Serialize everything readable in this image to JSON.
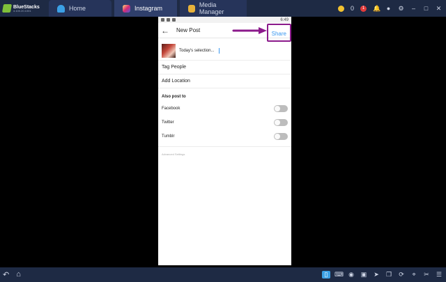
{
  "app": {
    "name": "BlueStacks",
    "version": "4.100.20.1001",
    "tabs": [
      {
        "label": "Home",
        "icon": "home-icon"
      },
      {
        "label": "Instagram",
        "icon": "instagram-icon"
      },
      {
        "label": "Media Manager",
        "icon": "folder-icon"
      }
    ],
    "coins": "0",
    "notification_count": "1"
  },
  "phone": {
    "status_time": "6:49",
    "screen_title": "New Post",
    "share_label": "Share",
    "caption_text": "Today's selection...",
    "rows": [
      "Tag People",
      "Add Location"
    ],
    "also_post_to": "Also post to",
    "toggles": [
      {
        "label": "Facebook",
        "on": false
      },
      {
        "label": "Twitter",
        "on": false
      },
      {
        "label": "Tumblr",
        "on": false
      }
    ],
    "advanced_settings": "Advanced Settings"
  },
  "colors": {
    "annotation": "#8b1a8b",
    "share": "#3897f0",
    "chrome": "#1e2a44"
  }
}
